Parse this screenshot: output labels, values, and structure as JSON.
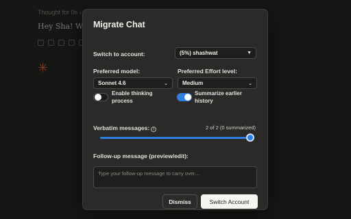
{
  "background": {
    "thought": "Thought for 0s",
    "message": "Hey Sha! What",
    "actions": [
      "copy-icon",
      "retry-icon",
      "thumbs-up-icon",
      "thumbs-down-icon",
      "share-icon"
    ],
    "logo": "claude-spark-icon",
    "star_glyph": "✳"
  },
  "modal": {
    "title": "Migrate Chat",
    "switch_account_label": "Switch to account:",
    "account_value": "(5%) shashwat",
    "model_label": "Preferred model:",
    "model_value": "Sonnet 4.6",
    "effort_label": "Preferred Effort level:",
    "effort_value": "Medium",
    "thinking_toggle": {
      "label": "Enable thinking process",
      "enabled": false
    },
    "summarize_toggle": {
      "label": "Summarize earlier history",
      "enabled": true
    },
    "verbatim_label": "Verbatim messages:",
    "verbatim_info_glyph": "i",
    "verbatim_count": "2 of 2 (0 summarized)",
    "verbatim_slider": {
      "value": 2,
      "max": 2
    },
    "followup_label": "Follow-up message (preview/edit):",
    "followup_placeholder": "Type your follow-up message to carry over...",
    "followup_value": "",
    "dismiss_label": "Dismiss",
    "switch_label": "Switch Account"
  },
  "colors": {
    "accent": "#2f7fe0",
    "background": "#262624",
    "modal": "#2b2a28",
    "logo": "#d9673f"
  }
}
